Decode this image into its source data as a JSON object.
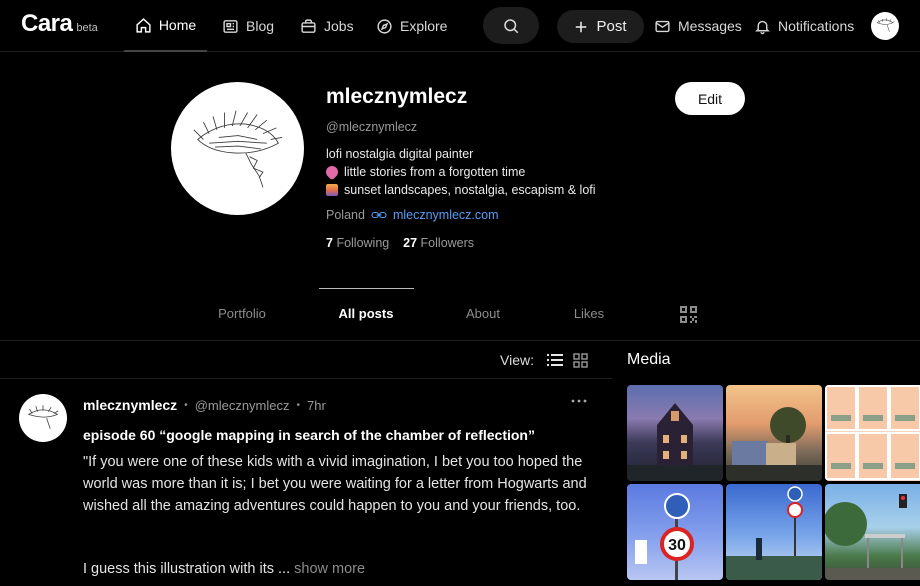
{
  "app": {
    "logo": "Cara",
    "badge": "beta"
  },
  "nav": {
    "home": "Home",
    "blog": "Blog",
    "jobs": "Jobs",
    "explore": "Explore",
    "post": "Post",
    "messages": "Messages",
    "notifications": "Notifications"
  },
  "profile": {
    "name": "mlecznymlecz",
    "handle": "@mlecznymlecz",
    "bio": [
      "lofi nostalgia digital painter",
      "little stories from a forgotten time",
      "sunset landscapes, nostalgia, escapism & lofi"
    ],
    "location": "Poland",
    "website": "mlecznymlecz.com",
    "following_count": "7",
    "following_label": "Following",
    "followers_count": "27",
    "followers_label": "Followers",
    "edit_label": "Edit"
  },
  "tabs": [
    "Portfolio",
    "All posts",
    "About",
    "Likes"
  ],
  "active_tab": "All posts",
  "view": {
    "label": "View:"
  },
  "post": {
    "author": "mlecznymlecz",
    "handle": "@mlecznymlecz",
    "time": "7hr",
    "title": "episode 60 “google mapping in search of the chamber of reflection”",
    "body": "\"If you were one of these kids with a vivid imagination, I bet you too hoped the world was more than it is; I bet you were waiting for a letter from Hogwarts and wished all the amazing adventures could happen to you and your friends, too.",
    "body_continued": "I guess this illustration with its ...",
    "show_more": "show more"
  },
  "media": {
    "title": "Media"
  },
  "colors": {
    "accent_link": "#5a9df5",
    "background": "#000000",
    "surface": "#1d1d1d"
  }
}
